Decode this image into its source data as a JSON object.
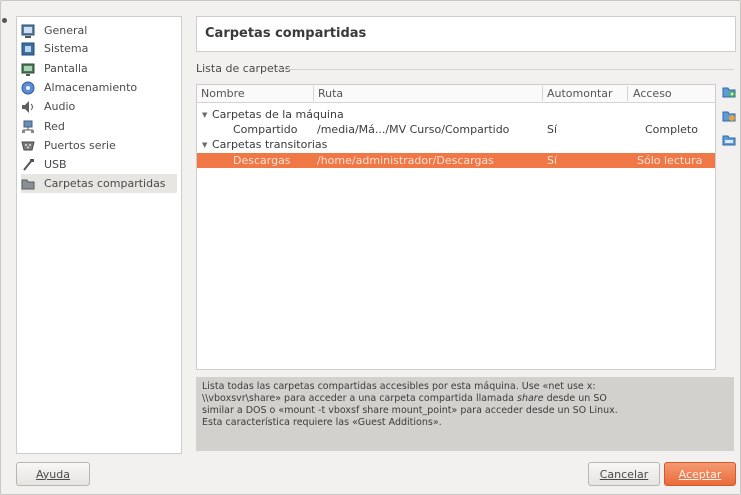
{
  "sidebar": {
    "items": [
      {
        "label": "General",
        "icon": "monitor-icon"
      },
      {
        "label": "Sistema",
        "icon": "chip-icon"
      },
      {
        "label": "Pantalla",
        "icon": "display-icon"
      },
      {
        "label": "Almacenamiento",
        "icon": "disk-icon"
      },
      {
        "label": "Audio",
        "icon": "speaker-icon"
      },
      {
        "label": "Red",
        "icon": "network-icon"
      },
      {
        "label": "Puertos serie",
        "icon": "serial-port-icon"
      },
      {
        "label": "USB",
        "icon": "usb-icon"
      },
      {
        "label": "Carpetas compartidas",
        "icon": "folder-icon"
      }
    ],
    "selected": "Carpetas compartidas"
  },
  "header": {
    "title": "Carpetas compartidas"
  },
  "group_label": "Lista de carpetas",
  "table": {
    "columns": [
      "Nombre",
      "Ruta",
      "Automontar",
      "Acceso"
    ],
    "groups": [
      {
        "label": "Carpetas de la máquina",
        "rows": [
          {
            "name": "Compartido",
            "path": "/media/Má.../MV Curso/Compartido",
            "auto": "Sí",
            "access": "Completo"
          }
        ]
      },
      {
        "label": "Carpetas transitorias",
        "rows": [
          {
            "name": "Descargas",
            "path": "/home/administrador/Descargas",
            "auto": "Sí",
            "access": "Sólo lectura"
          }
        ]
      }
    ]
  },
  "side_buttons": [
    "add-folder-icon",
    "edit-folder-icon",
    "remove-folder-icon"
  ],
  "info": {
    "line1": "Lista todas las carpetas compartidas accesibles por esta máquina. Use «net use x:",
    "line2a": "\\\\vboxsvr\\share» para acceder a una carpeta compartida llamada ",
    "line2b": "share",
    "line2c": " desde un SO",
    "line3": "similar a DOS o «mount -t vboxsf share mount_point» para acceder desde un SO Linux.",
    "line4": "Esta característica requiere las «Guest Additions»."
  },
  "buttons": {
    "help": "Ayuda",
    "cancel": "Cancelar",
    "accept": "Aceptar"
  },
  "colors": {
    "selection": "#f07746",
    "accent_button": "#ea6a3a"
  }
}
